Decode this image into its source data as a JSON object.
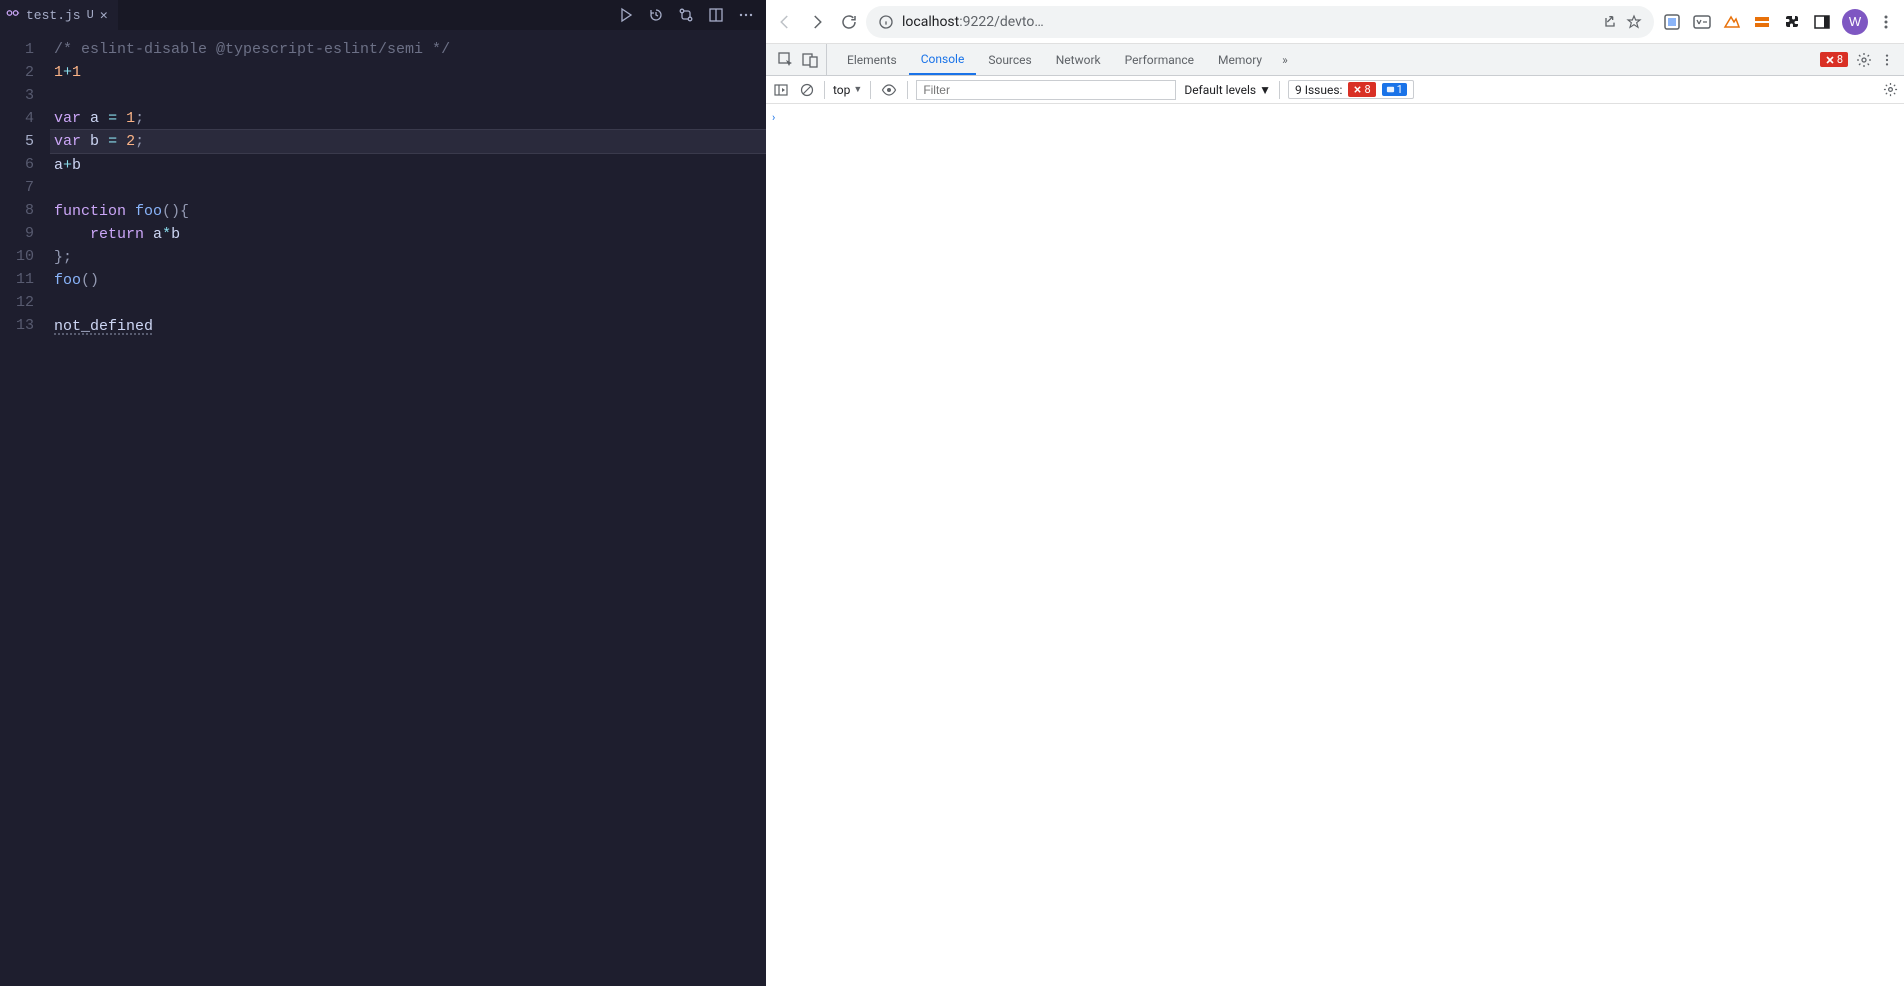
{
  "editor": {
    "tab": {
      "filename": "test.js",
      "status": "U"
    },
    "icons": {
      "run": "run-icon",
      "history": "history-icon",
      "diff": "diff-icon",
      "split": "split-icon",
      "more": "more-icon"
    },
    "currentLine": 5,
    "lines": [
      {
        "n": 1,
        "tokens": [
          {
            "t": "/* eslint-disable @typescript-eslint/semi */",
            "c": "c-comment"
          }
        ]
      },
      {
        "n": 2,
        "tokens": [
          {
            "t": "1",
            "c": "c-number"
          },
          {
            "t": "+",
            "c": "c-op"
          },
          {
            "t": "1",
            "c": "c-number"
          }
        ]
      },
      {
        "n": 3,
        "tokens": []
      },
      {
        "n": 4,
        "tokens": [
          {
            "t": "var",
            "c": "c-keyword"
          },
          {
            "t": " ",
            "c": ""
          },
          {
            "t": "a",
            "c": "c-var"
          },
          {
            "t": " ",
            "c": ""
          },
          {
            "t": "=",
            "c": "c-op"
          },
          {
            "t": " ",
            "c": ""
          },
          {
            "t": "1",
            "c": "c-number"
          },
          {
            "t": ";",
            "c": "c-punct"
          }
        ]
      },
      {
        "n": 5,
        "tokens": [
          {
            "t": "var",
            "c": "c-keyword"
          },
          {
            "t": " ",
            "c": ""
          },
          {
            "t": "b",
            "c": "c-var"
          },
          {
            "t": " ",
            "c": ""
          },
          {
            "t": "=",
            "c": "c-op"
          },
          {
            "t": " ",
            "c": ""
          },
          {
            "t": "2",
            "c": "c-number"
          },
          {
            "t": ";",
            "c": "c-punct"
          }
        ]
      },
      {
        "n": 6,
        "tokens": [
          {
            "t": "a",
            "c": "c-var"
          },
          {
            "t": "+",
            "c": "c-op"
          },
          {
            "t": "b",
            "c": "c-var"
          }
        ]
      },
      {
        "n": 7,
        "tokens": []
      },
      {
        "n": 8,
        "tokens": [
          {
            "t": "function",
            "c": "c-keyword"
          },
          {
            "t": " ",
            "c": ""
          },
          {
            "t": "foo",
            "c": "c-funcdef"
          },
          {
            "t": "(){",
            "c": "c-punct"
          }
        ]
      },
      {
        "n": 9,
        "tokens": [
          {
            "t": "    ",
            "c": ""
          },
          {
            "t": "return",
            "c": "c-return"
          },
          {
            "t": " ",
            "c": ""
          },
          {
            "t": "a",
            "c": "c-var"
          },
          {
            "t": "*",
            "c": "c-op"
          },
          {
            "t": "b",
            "c": "c-var"
          }
        ]
      },
      {
        "n": 10,
        "tokens": [
          {
            "t": "};",
            "c": "c-punct"
          }
        ]
      },
      {
        "n": 11,
        "tokens": [
          {
            "t": "foo",
            "c": "c-func"
          },
          {
            "t": "()",
            "c": "c-punct"
          }
        ]
      },
      {
        "n": 12,
        "tokens": []
      },
      {
        "n": 13,
        "tokens": [
          {
            "t": "not_defined",
            "c": "c-undef"
          }
        ]
      }
    ]
  },
  "browser": {
    "url_host": "localhost",
    "url_rest": ":9222/devto…",
    "avatar_letter": "W"
  },
  "devtools": {
    "tabs": [
      "Elements",
      "Console",
      "Sources",
      "Network",
      "Performance",
      "Memory"
    ],
    "activeTab": "Console",
    "errorCount": "8",
    "console": {
      "context": "top",
      "filterPlaceholder": "Filter",
      "levels": "Default levels",
      "issuesLabel": "9 Issues:",
      "issuesError": "8",
      "issuesInfo": "1"
    }
  }
}
